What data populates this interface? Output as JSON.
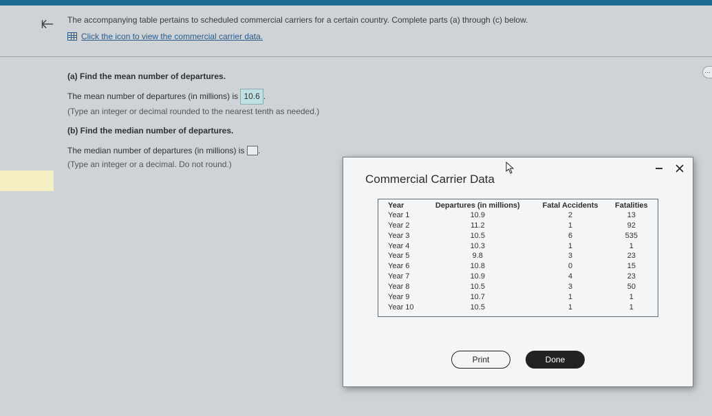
{
  "intro": "The accompanying table pertains to scheduled commercial carriers for a certain country. Complete parts (a) through (c) below.",
  "link": {
    "label": "Click the icon to view the commercial carrier data."
  },
  "q_a": {
    "label": "(a) Find the mean number of departures.",
    "answer_prefix": "The mean number of departures (in millions) is ",
    "answer_value": "10.6",
    "answer_suffix": ".",
    "hint": "(Type an integer or decimal rounded to the nearest tenth as needed.)"
  },
  "q_b": {
    "label": "(b) Find the median number of departures.",
    "answer_prefix": "The median number of departures (in millions) is ",
    "hint": "(Type an integer or a decimal. Do not round.)"
  },
  "modal": {
    "title": "Commercial Carrier Data",
    "headers": [
      "Year",
      "Departures (in millions)",
      "Fatal Accidents",
      "Fatalities"
    ],
    "rows": [
      {
        "year": "Year 1",
        "dep": "10.9",
        "acc": "2",
        "fat": "13"
      },
      {
        "year": "Year 2",
        "dep": "11.2",
        "acc": "1",
        "fat": "92"
      },
      {
        "year": "Year 3",
        "dep": "10.5",
        "acc": "6",
        "fat": "535"
      },
      {
        "year": "Year 4",
        "dep": "10.3",
        "acc": "1",
        "fat": "1"
      },
      {
        "year": "Year 5",
        "dep": "9.8",
        "acc": "3",
        "fat": "23"
      },
      {
        "year": "Year 6",
        "dep": "10.8",
        "acc": "0",
        "fat": "15"
      },
      {
        "year": "Year 7",
        "dep": "10.9",
        "acc": "4",
        "fat": "23"
      },
      {
        "year": "Year 8",
        "dep": "10.5",
        "acc": "3",
        "fat": "50"
      },
      {
        "year": "Year 9",
        "dep": "10.7",
        "acc": "1",
        "fat": "1"
      },
      {
        "year": "Year 10",
        "dep": "10.5",
        "acc": "1",
        "fat": "1"
      }
    ],
    "buttons": {
      "print": "Print",
      "done": "Done"
    }
  },
  "ellipsis": "⋯"
}
